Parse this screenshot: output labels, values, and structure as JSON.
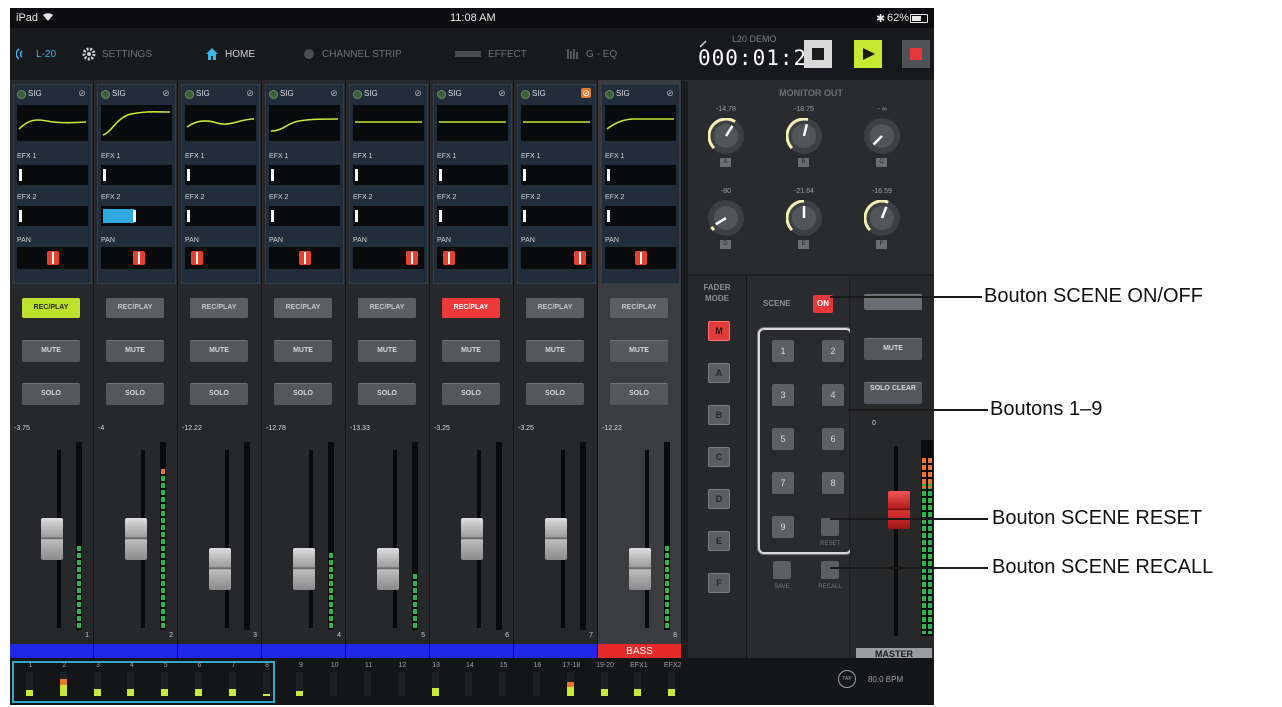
{
  "status_bar": {
    "device": "iPad",
    "wifi_icon": "wifi-icon",
    "time": "11:08 AM",
    "battery": "62%",
    "bluetooth_icon": "bluetooth-icon"
  },
  "nav": {
    "device_label": "L-20",
    "items": [
      {
        "label": "SETTINGS",
        "icon": "gear-icon"
      },
      {
        "label": "HOME",
        "icon": "home-icon"
      },
      {
        "label": "CHANNEL STRIP",
        "icon": "channel-strip-icon"
      },
      {
        "label": "EFFECT",
        "icon": "effect-icon"
      },
      {
        "label": "G - EQ",
        "icon": "geq-icon"
      }
    ]
  },
  "transport": {
    "project": "L20 DEMO",
    "timecode": "000:01:28"
  },
  "channels": [
    {
      "sig": "SIG",
      "efx1": "EFX 1",
      "efx2": "EFX 2",
      "efx2_level": 0.0,
      "pan": "PAN",
      "pan_pos": 0.5,
      "rec": "REC/PLAY",
      "rec_state": "green",
      "mute": "MUTE",
      "solo": "SOLO",
      "db": "-3.75",
      "fader": 0.55,
      "meter": 0.45,
      "num": "1",
      "name": "",
      "phase_on": false
    },
    {
      "sig": "SIG",
      "efx1": "EFX 1",
      "efx2": "EFX 2",
      "efx2_level": 0.45,
      "pan": "PAN",
      "pan_pos": 0.55,
      "rec": "REC/PLAY",
      "rec_state": "off",
      "mute": "MUTE",
      "solo": "SOLO",
      "db": "-4",
      "fader": 0.55,
      "meter": 0.88,
      "num": "2",
      "name": "",
      "phase_on": false
    },
    {
      "sig": "SIG",
      "efx1": "EFX 1",
      "efx2": "EFX 2",
      "efx2_level": 0.0,
      "pan": "PAN",
      "pan_pos": 0.08,
      "rec": "REC/PLAY",
      "rec_state": "off",
      "mute": "MUTE",
      "solo": "SOLO",
      "db": "-12.22",
      "fader": 0.35,
      "meter": 0.0,
      "num": "3",
      "name": "",
      "phase_on": false
    },
    {
      "sig": "SIG",
      "efx1": "EFX 1",
      "efx2": "EFX 2",
      "efx2_level": 0.0,
      "pan": "PAN",
      "pan_pos": 0.5,
      "rec": "REC/PLAY",
      "rec_state": "off",
      "mute": "MUTE",
      "solo": "SOLO",
      "db": "-12.78",
      "fader": 0.35,
      "meter": 0.42,
      "num": "4",
      "name": "",
      "phase_on": false
    },
    {
      "sig": "SIG",
      "efx1": "EFX 1",
      "efx2": "EFX 2",
      "efx2_level": 0.0,
      "pan": "PAN",
      "pan_pos": 0.92,
      "rec": "REC/PLAY",
      "rec_state": "off",
      "mute": "MUTE",
      "solo": "SOLO",
      "db": "-13.33",
      "fader": 0.35,
      "meter": 0.3,
      "num": "5",
      "name": "",
      "phase_on": false
    },
    {
      "sig": "SIG",
      "efx1": "EFX 1",
      "efx2": "EFX 2",
      "efx2_level": 0.0,
      "pan": "PAN",
      "pan_pos": 0.08,
      "rec": "REC/PLAY",
      "rec_state": "red",
      "mute": "MUTE",
      "solo": "SOLO",
      "db": "-3.25",
      "fader": 0.55,
      "meter": 0.0,
      "num": "6",
      "name": "",
      "phase_on": false
    },
    {
      "sig": "SIG",
      "efx1": "EFX 1",
      "efx2": "EFX 2",
      "efx2_level": 0.0,
      "pan": "PAN",
      "pan_pos": 0.92,
      "rec": "REC/PLAY",
      "rec_state": "off",
      "mute": "MUTE",
      "solo": "SOLO",
      "db": "-3.25",
      "fader": 0.55,
      "meter": 0.0,
      "num": "7",
      "name": "",
      "phase_on": true
    },
    {
      "sig": "SIG",
      "efx1": "EFX 1",
      "efx2": "EFX 2",
      "efx2_level": 0.0,
      "pan": "PAN",
      "pan_pos": 0.5,
      "rec": "REC/PLAY",
      "rec_state": "off",
      "mute": "MUTE",
      "solo": "SOLO",
      "db": "-12.22",
      "fader": 0.35,
      "meter": 0.45,
      "num": "8",
      "name": "BASS",
      "phase_on": false
    }
  ],
  "monitor_out": {
    "title": "MONITOR OUT",
    "knobs": [
      {
        "value": "-14.78",
        "letter": "A",
        "level": 0.62
      },
      {
        "value": "-18.75",
        "letter": "B",
        "level": 0.55
      },
      {
        "value": "- ∞",
        "letter": "C",
        "level": 0.0
      },
      {
        "value": "-80",
        "letter": "D",
        "level": 0.05
      },
      {
        "value": "-21.64",
        "letter": "E",
        "level": 0.5
      },
      {
        "value": "-16.59",
        "letter": "F",
        "level": 0.58
      }
    ]
  },
  "fader_mode": {
    "title_line1": "FADER",
    "title_line2": "MODE",
    "buttons": [
      "M",
      "A",
      "B",
      "C",
      "D",
      "E",
      "F"
    ],
    "active": "M"
  },
  "scene": {
    "title": "SCENE",
    "on_label": "ON",
    "buttons": [
      "1",
      "2",
      "3",
      "4",
      "5",
      "6",
      "7",
      "8",
      "9"
    ],
    "save_label": "SAVE",
    "reset_label": "RESET",
    "recall_label": "RECALL"
  },
  "master": {
    "mute": "MUTE",
    "solo_clear": "SOLO CLEAR",
    "db": "0",
    "name": "MASTER",
    "fader": 0.7
  },
  "tab_bar": {
    "channels": [
      "1",
      "2",
      "3",
      "4",
      "5",
      "6",
      "7",
      "8",
      "9",
      "10",
      "11",
      "12",
      "13",
      "14",
      "15",
      "16",
      "17-18",
      "19-20",
      "EFX1",
      "EFX2"
    ],
    "levels": [
      0.25,
      0.7,
      0.3,
      0.3,
      0.3,
      0.3,
      0.3,
      0.1,
      0.2,
      0.0,
      0.0,
      0.0,
      0.35,
      0.0,
      0.0,
      0.0,
      0.6,
      0.3,
      0.3,
      0.3
    ],
    "tap_label": "TAP",
    "bpm": "80.0 BPM"
  },
  "annotations": [
    {
      "text": "Bouton SCENE ON/OFF"
    },
    {
      "text": "Boutons 1–9"
    },
    {
      "text": "Bouton SCENE RESET"
    },
    {
      "text": "Bouton SCENE RECALL"
    }
  ],
  "colors": {
    "accent_green": "#bde22c",
    "record_red": "#e63838",
    "channel_blue": "#1f28e6",
    "meter_green": "#31b34b",
    "meter_orange": "#e9782d"
  }
}
